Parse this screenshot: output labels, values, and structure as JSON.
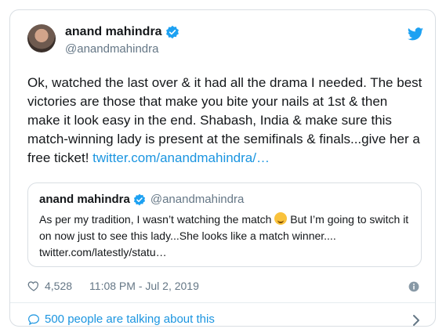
{
  "tweet": {
    "display_name": "anand mahindra",
    "handle": "@anandmahindra",
    "text_plain": "Ok, watched the last over & it had all the drama I needed. The best victories are those that make you bite your nails at 1st & then make it look easy in the end. Shabash, India & make sure this match-winning lady is present at the semifinals & finals...give her a free ticket! ",
    "text_link": "twitter.com/anandmahindra/…",
    "likes": "4,528",
    "time": "11:08 PM - Jul 2, 2019",
    "conversation": "500 people are talking about this"
  },
  "quoted": {
    "display_name": "anand mahindra",
    "handle": "@anandmahindra",
    "text_before_emoji": "As per my tradition, I wasn’t watching the match ",
    "text_after_emoji": " But I’m going to switch it on now just to see this lady...She looks like a match winner....",
    "link": "twitter.com/latestly/statu…"
  },
  "icons": {
    "brand": "twitter-bird-icon",
    "verified": "verified-badge-icon",
    "like": "heart-icon",
    "info": "info-icon",
    "conversation": "speech-bubble-icon",
    "expand": "chevron-right-icon"
  },
  "colors": {
    "link": "#1b95e0",
    "secondary_text": "#657786",
    "border": "#d9dee3"
  }
}
